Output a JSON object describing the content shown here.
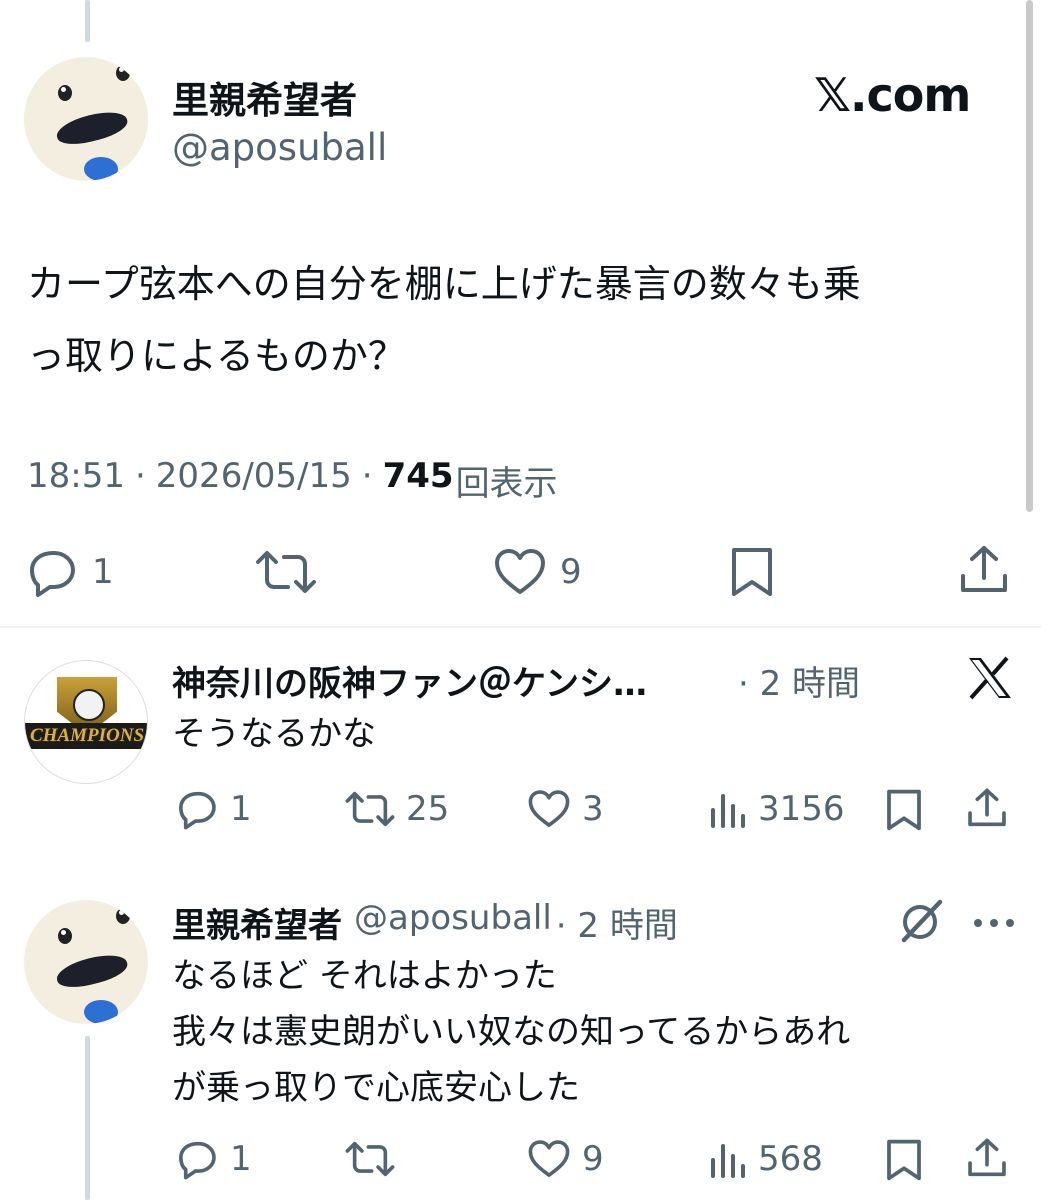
{
  "main_tweet": {
    "display_name": "里親希望者",
    "handle": "@aposuball",
    "brand": "𝕏.com",
    "text_lines": [
      "カープ弦本への自分を棚に上げた暴言の数々も乗",
      "っ取りによるものか？"
    ],
    "time": "18:51",
    "date": "2026/05/15",
    "sep": "·",
    "views_count": "745",
    "views_label": "回表示",
    "reply_count": "1",
    "like_count": "9",
    "icons": [
      "reply-icon",
      "retweet-icon",
      "like-icon",
      "bookmark-icon",
      "share-icon"
    ]
  },
  "reply_1": {
    "display_name": "神奈川の阪神ファン＠ケンシ…",
    "time": "· 2 時間",
    "avatar_text": "CHAMPIONS",
    "text": "そうなるかな",
    "reply_count": "1",
    "retweet_count": "25",
    "like_count": "3",
    "view_count": "3156",
    "corner_icon": "x-logo-icon"
  },
  "reply_2": {
    "display_name": "里親希望者",
    "handle": "@aposuball",
    "time": "· 2 時間",
    "text_lines": [
      "なるほど それはよかった",
      "我々は憲史朗がいい奴なの知ってるからあれ",
      "が乗っ取りで心底安心した"
    ],
    "reply_count": "1",
    "like_count": "9",
    "view_count": "568",
    "corner_icons": [
      "grok-icon",
      "more-icon"
    ]
  },
  "colors": {
    "text": "#0f1419",
    "secondary": "#536471",
    "divider": "#eff3f4",
    "thread_line": "#cfd9de"
  }
}
